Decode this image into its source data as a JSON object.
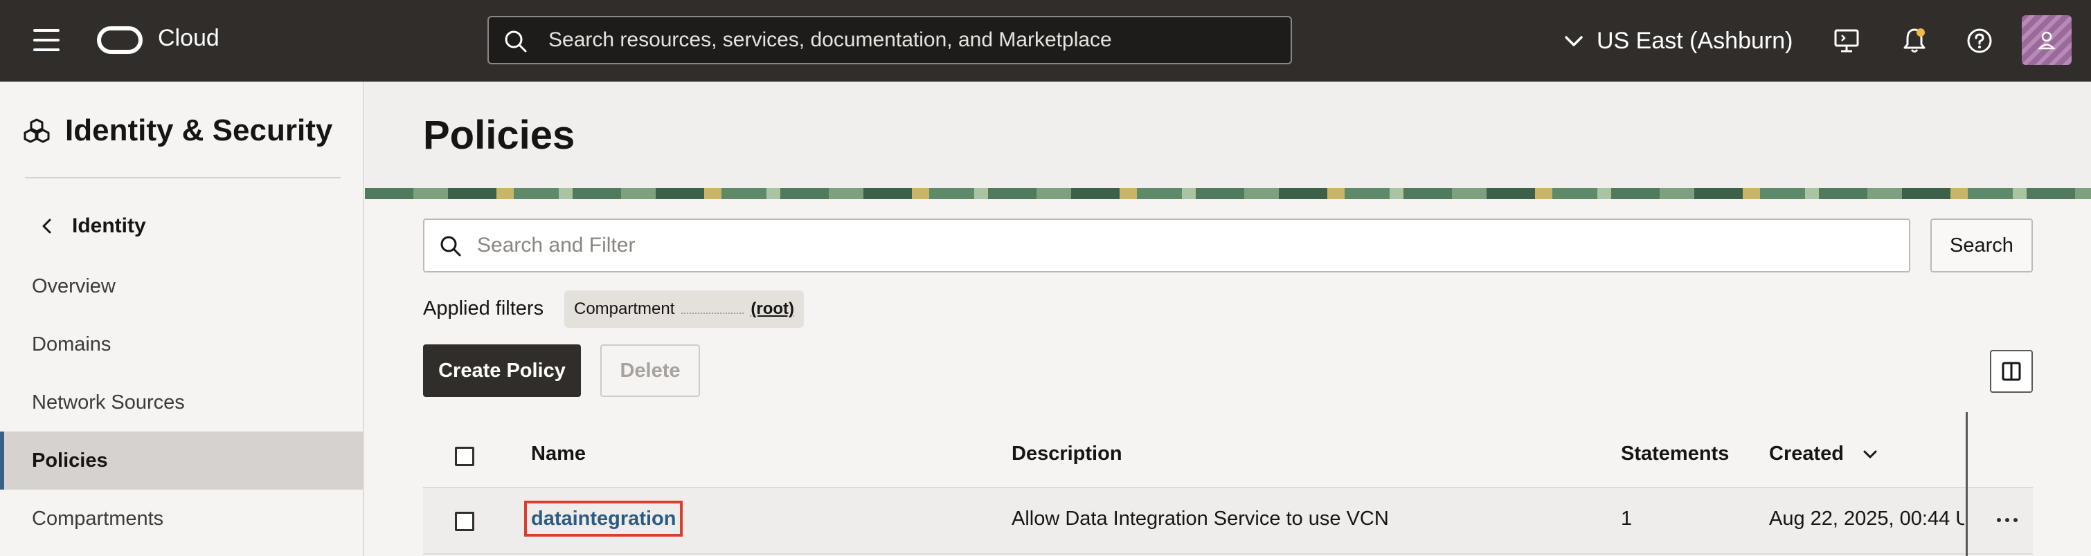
{
  "topbar": {
    "brand": "Cloud",
    "search_placeholder": "Search resources, services, documentation, and Marketplace",
    "region": "US East (Ashburn)"
  },
  "sidebar": {
    "title": "Identity & Security",
    "back_label": "Identity",
    "items": [
      {
        "label": "Overview"
      },
      {
        "label": "Domains"
      },
      {
        "label": "Network Sources"
      },
      {
        "label": "Policies",
        "active": true
      },
      {
        "label": "Compartments"
      }
    ]
  },
  "main": {
    "title": "Policies",
    "search_placeholder": "Search and Filter",
    "search_button": "Search",
    "applied_filters_label": "Applied filters",
    "filter_chip": {
      "key": "Compartment",
      "value": "(root)"
    },
    "create_button": "Create Policy",
    "delete_button": "Delete",
    "table": {
      "columns": [
        "Name",
        "Description",
        "Statements",
        "Created"
      ],
      "rows": [
        {
          "name": "dataintegration",
          "description": "Allow Data Integration Service to use VCN",
          "statements": "1",
          "created": "Aug 22, 2025, 00:44 U"
        }
      ]
    }
  },
  "colors": {
    "topbar_bg": "#312d2a",
    "primary_button": "#312d2a",
    "link": "#2c5b82",
    "highlight_box": "#d9402b",
    "active_nav_accent": "#3a5e84"
  },
  "icons": [
    "menu-icon",
    "oracle-logo-icon",
    "search-icon",
    "chevron-down-icon",
    "cloud-shell-icon",
    "bell-icon",
    "help-icon",
    "user-icon",
    "identity-cubes-icon",
    "chevron-left-icon",
    "columns-icon",
    "kebab-menu-icon"
  ]
}
